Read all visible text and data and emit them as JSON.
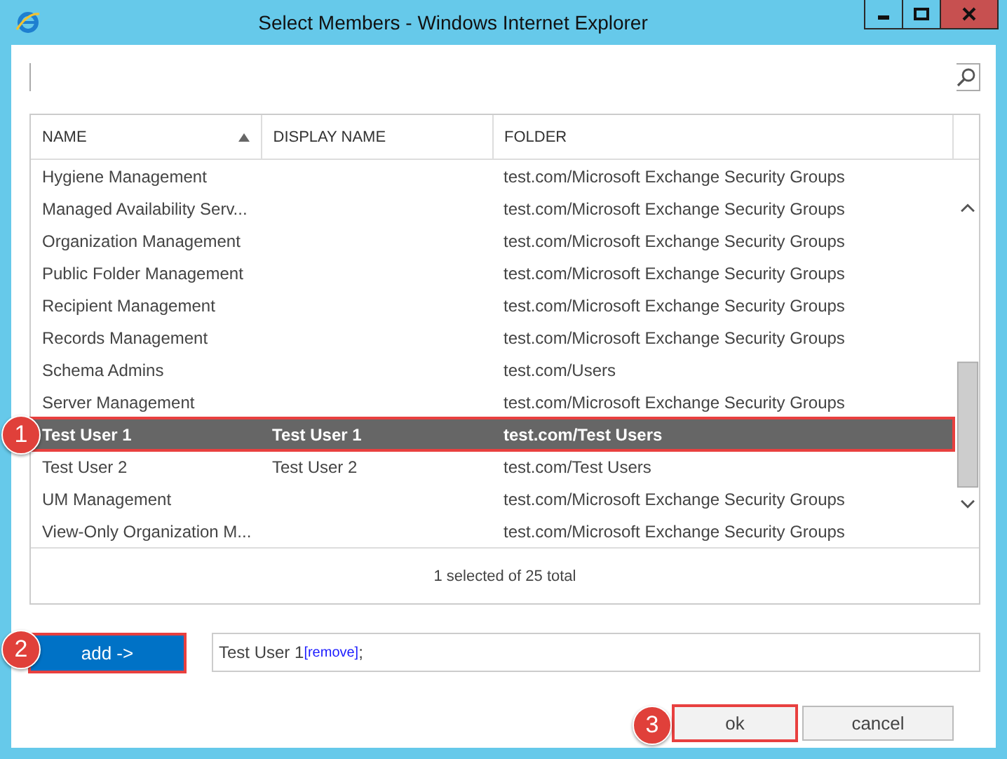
{
  "window": {
    "title": "Select Members - Windows Internet Explorer"
  },
  "table": {
    "columns": [
      {
        "label": "NAME",
        "sorted": true
      },
      {
        "label": "DISPLAY NAME",
        "sorted": false
      },
      {
        "label": "FOLDER",
        "sorted": false
      }
    ],
    "rows": [
      {
        "cells": [
          "Hygiene Management",
          "",
          "test.com/Microsoft Exchange Security Groups"
        ],
        "selected": false
      },
      {
        "cells": [
          "Managed Availability Serv...",
          "",
          "test.com/Microsoft Exchange Security Groups"
        ],
        "selected": false
      },
      {
        "cells": [
          "Organization Management",
          "",
          "test.com/Microsoft Exchange Security Groups"
        ],
        "selected": false
      },
      {
        "cells": [
          "Public Folder Management",
          "",
          "test.com/Microsoft Exchange Security Groups"
        ],
        "selected": false
      },
      {
        "cells": [
          "Recipient Management",
          "",
          "test.com/Microsoft Exchange Security Groups"
        ],
        "selected": false
      },
      {
        "cells": [
          "Records Management",
          "",
          "test.com/Microsoft Exchange Security Groups"
        ],
        "selected": false
      },
      {
        "cells": [
          "Schema Admins",
          "",
          "test.com/Users"
        ],
        "selected": false
      },
      {
        "cells": [
          "Server Management",
          "",
          "test.com/Microsoft Exchange Security Groups"
        ],
        "selected": false
      },
      {
        "cells": [
          "Test User 1",
          "Test User 1",
          "test.com/Test Users"
        ],
        "selected": true,
        "callout": "1"
      },
      {
        "cells": [
          "Test User 2",
          "Test User 2",
          "test.com/Test Users"
        ],
        "selected": false
      },
      {
        "cells": [
          "UM Management",
          "",
          "test.com/Microsoft Exchange Security Groups"
        ],
        "selected": false
      },
      {
        "cells": [
          "View-Only Organization M...",
          "",
          "test.com/Microsoft Exchange Security Groups"
        ],
        "selected": false
      }
    ],
    "status": "1 selected of 25 total"
  },
  "add_button": {
    "label": "add ->",
    "callout": "2"
  },
  "members": [
    {
      "name": "Test User 1",
      "link": "[remove]",
      "separator": ";"
    }
  ],
  "buttons": [
    {
      "label": "ok",
      "callout": "3"
    },
    {
      "label": "cancel"
    }
  ]
}
